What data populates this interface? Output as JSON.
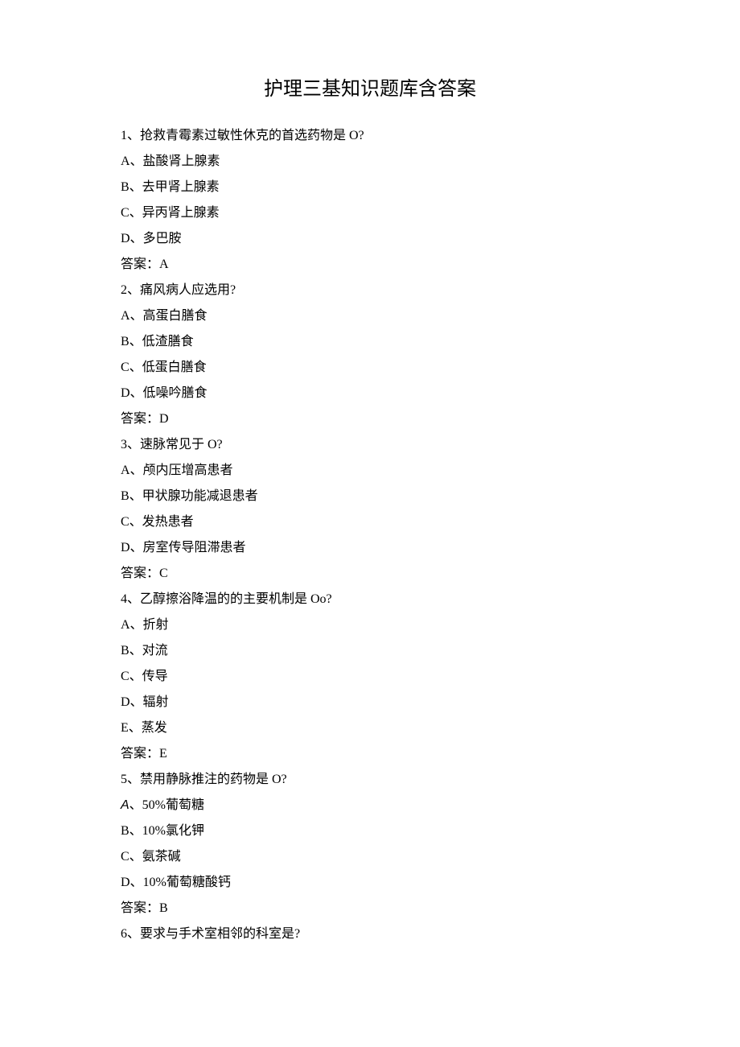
{
  "title": "护理三基知识题库含答案",
  "questions": [
    {
      "stem": "1、抢救青霉素过敏性休克的首选药物是 O?",
      "options": [
        "A、盐酸肾上腺素",
        "B、去甲肾上腺素",
        "C、异丙肾上腺素",
        "D、多巴胺"
      ],
      "answer": "答案：A"
    },
    {
      "stem": "2、痛风病人应选用?",
      "options": [
        "A、高蛋白膳食",
        "B、低渣膳食",
        "C、低蛋白膳食",
        "D、低噪吟膳食"
      ],
      "answer": "答案：D"
    },
    {
      "stem": "3、速脉常见于 O?",
      "options": [
        "A、颅内压增高患者",
        "B、甲状腺功能减退患者",
        "C、发热患者",
        "D、房室传导阻滞患者"
      ],
      "answer": "答案：C"
    },
    {
      "stem": "4、乙醇擦浴降温的的主要机制是 Oo?",
      "options": [
        "A、折射",
        "B、对流",
        "C、传导",
        "D、辐射",
        "E、蒸发"
      ],
      "answer": "答案：E"
    },
    {
      "stem": "5、禁用静脉推注的药物是 O?",
      "options": [
        {
          "prefix_italic": "A",
          "rest": "、50%葡萄糖"
        },
        "B、10%氯化钾",
        "C、氨茶碱",
        "D、10%葡萄糖酸钙"
      ],
      "answer": "答案：B"
    },
    {
      "stem": "6、要求与手术室相邻的科室是?",
      "options": [],
      "answer": ""
    }
  ]
}
